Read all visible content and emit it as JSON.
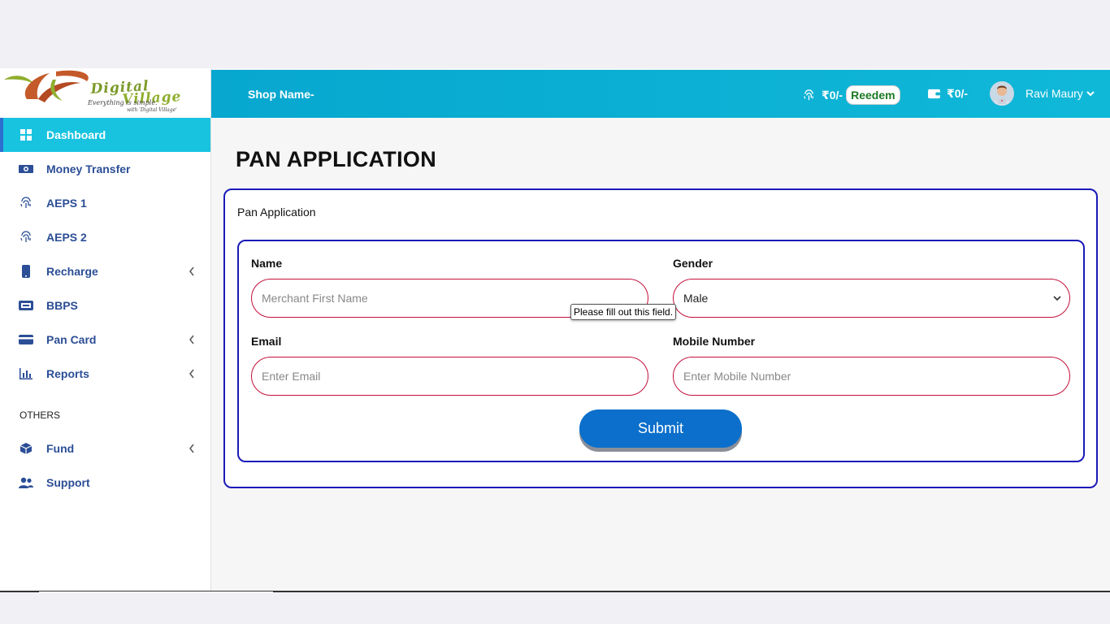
{
  "logo": {
    "title_line1": "Digital",
    "title_line2": "Village",
    "tagline_line1": "Everything is simple.",
    "tagline_line2": "with 'Digital Village'"
  },
  "sidebar": {
    "items": [
      {
        "label": "Dashboard",
        "icon": "dashboard-grid-icon",
        "active": true
      },
      {
        "label": "Money Transfer",
        "icon": "money-icon"
      },
      {
        "label": "AEPS 1",
        "icon": "fingerprint-icon"
      },
      {
        "label": "AEPS 2",
        "icon": "fingerprint-icon"
      },
      {
        "label": "Recharge",
        "icon": "mobile-icon",
        "expandable": true
      },
      {
        "label": "BBPS",
        "icon": "bill-icon"
      },
      {
        "label": "Pan Card",
        "icon": "credit-card-icon",
        "expandable": true
      },
      {
        "label": "Reports",
        "icon": "chart-icon",
        "expandable": true
      }
    ],
    "section_label": "OTHERS",
    "other_items": [
      {
        "label": "Fund",
        "icon": "box-icon",
        "expandable": true
      },
      {
        "label": "Support",
        "icon": "users-icon"
      }
    ]
  },
  "header": {
    "shop_label": "Shop Name-",
    "aeps_balance": "₹0/-",
    "redeem_label": "Reedem",
    "wallet_balance": "₹0/-",
    "user_name": "Ravi Maury"
  },
  "main": {
    "page_title": "PAN APPLICATION",
    "card_title": "Pan Application",
    "form": {
      "name_label": "Name",
      "name_placeholder": "Merchant First Name",
      "gender_label": "Gender",
      "gender_value": "Male",
      "email_label": "Email",
      "email_placeholder": "Enter Email",
      "mobile_label": "Mobile Number",
      "mobile_placeholder": "Enter Mobile Number",
      "validation_tooltip": "Please fill out this field.",
      "submit_label": "Submit"
    }
  },
  "colors": {
    "accent": "#18c3e0",
    "header": "#07a7cf",
    "nav_text": "#2b4e96",
    "border_blue": "#1a1ab8",
    "input_border": "#c3103c",
    "submit": "#0b6fcb",
    "redeem_text": "#1c7a23"
  }
}
